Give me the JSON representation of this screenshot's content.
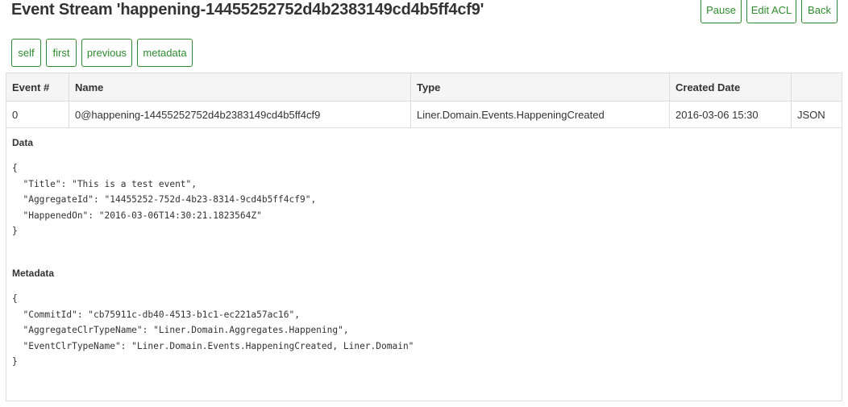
{
  "page": {
    "title": "Event Stream 'happening-14455252752d4b2383149cd4b5ff4cf9'"
  },
  "header_actions": {
    "pause": "Pause",
    "edit_acl": "Edit ACL",
    "back": "Back"
  },
  "nav": {
    "self": "self",
    "first": "first",
    "previous": "previous",
    "metadata": "metadata"
  },
  "table": {
    "columns": [
      "Event #",
      "Name",
      "Type",
      "Created Date",
      ""
    ],
    "row": {
      "event_number": "0",
      "name": "0@happening-14455252752d4b2383149cd4b5ff4cf9",
      "type": "Liner.Domain.Events.HappeningCreated",
      "created_date": "2016-03-06 15:30",
      "json_link": "JSON"
    }
  },
  "details": {
    "data_label": "Data",
    "data_json": "{\n  \"Title\": \"This is a test event\",\n  \"AggregateId\": \"14455252-752d-4b23-8314-9cd4b5ff4cf9\",\n  \"HappenedOn\": \"2016-03-06T14:30:21.1823564Z\"\n}",
    "metadata_label": "Metadata",
    "metadata_json": "{\n  \"CommitId\": \"cb75911c-db40-4513-b1c1-ec221a57ac16\",\n  \"AggregateClrTypeName\": \"Liner.Domain.Aggregates.Happening\",\n  \"EventClrTypeName\": \"Liner.Domain.Events.HappeningCreated, Liner.Domain\"\n}"
  },
  "colors": {
    "accent": "#2e8b2e",
    "header_bg": "#f5f5f5",
    "border": "#dddddd",
    "text": "#333333"
  }
}
